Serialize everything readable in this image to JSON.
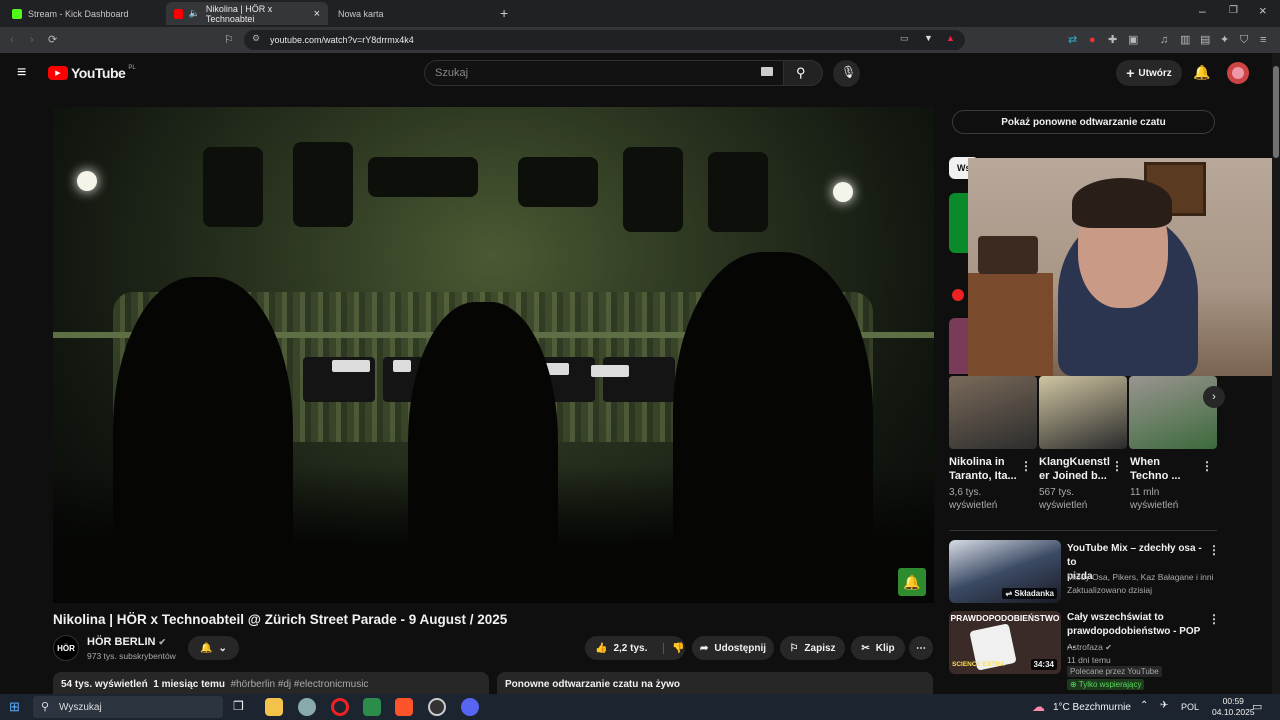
{
  "browser": {
    "tabs": [
      {
        "label": "Stream - Kick Dashboard",
        "color": "#53fc18"
      },
      {
        "label": "Nikolina | HÖR x Technoabtei",
        "color": "#ff0000"
      },
      {
        "label": "Nowa karta",
        "color": ""
      }
    ],
    "url": "youtube.com/watch?v=rY8drrmx4k4"
  },
  "youtube": {
    "logo": "YouTube",
    "region": "PL",
    "search_placeholder": "Szukaj",
    "create_label": "Utwórz"
  },
  "video": {
    "title": "Nikolina | HÖR x Technoabteil @ Zürich Street Parade - 9 August / 2025",
    "channel_name": "HÖR BERLIN",
    "channel_avatar_text": "HÖR",
    "subscribers": "973 tys. subskrybentów",
    "likes": "2,2 tys.",
    "share_label": "Udostępnij",
    "save_label": "Zapisz",
    "clip_label": "Klip",
    "views": "54 tys. wyświetleń",
    "date": "1 miesiąc temu",
    "tags": "#hörberlin #dj #electronicmusic",
    "replay_box": "Ponowne odtwarzanie czatu na żywo"
  },
  "sidebar": {
    "chat_replay_button": "Pokaż ponowne odtwarzanie czatu",
    "chip": "Ws",
    "shorts": [
      {
        "title_line1": "Nikolina in",
        "title_line2": "Taranto, Ita...",
        "views_line1": "3,6 tys.",
        "views_line2": "wyświetleń"
      },
      {
        "title_line1": "KlangKuenstl",
        "title_line2": "er Joined b...",
        "views_line1": "567 tys.",
        "views_line2": "wyświetleń"
      },
      {
        "title_line1": "When",
        "title_line2": "Techno ...",
        "views_line1": "11 mln",
        "views_line2": "wyświetleń"
      }
    ],
    "recs": [
      {
        "title_line1": "YouTube Mix – zdechły osa - to",
        "title_line2": "pizda",
        "sub1": "Młody Osa, Pikers, Kaz Bałagane i inni",
        "sub2": "Zaktualizowano dzisiaj",
        "badge": "Składanka"
      },
      {
        "title_line1": "Cały wszechświat to",
        "title_line2": "prawdopodobieństwo - POP ...",
        "channel": "Astrofaza",
        "age": "11 dni temu",
        "promo": "Polecane przez YouTube",
        "members": "Tylko wspierający",
        "duration": "34:34",
        "thumb_text": "PRAWDOPODOBIEŃSTWO",
        "thumb_sub": "SCIENCE EXTRA"
      }
    ]
  },
  "taskbar": {
    "search": "Wyszukaj",
    "weather": "1°C  Bezchmurnie",
    "lang": "POL",
    "time": "00:59",
    "date": "04.10.2025"
  }
}
